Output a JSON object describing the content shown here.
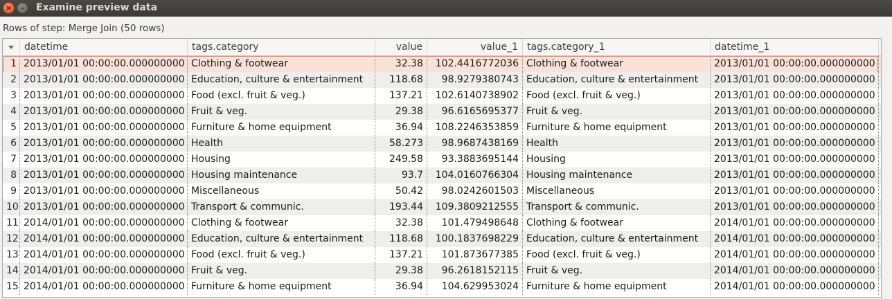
{
  "window": {
    "title": "Examine preview data"
  },
  "subtitle": "Rows of step: Merge Join (50 rows)",
  "columns": [
    "datetime",
    "tags.category",
    "value",
    "value_1",
    "tags.category_1",
    "datetime_1"
  ],
  "rows": [
    {
      "n": "1",
      "datetime": "2013/01/01 00:00:00.000000000",
      "category": "Clothing & footwear",
      "value": "32.38",
      "value_1": "102.4416772036",
      "category_1": "Clothing & footwear",
      "datetime_1": "2013/01/01 00:00:00.000000000"
    },
    {
      "n": "2",
      "datetime": "2013/01/01 00:00:00.000000000",
      "category": "Education, culture & entertainment",
      "value": "118.68",
      "value_1": "98.9279380743",
      "category_1": "Education, culture & entertainment",
      "datetime_1": "2013/01/01 00:00:00.000000000"
    },
    {
      "n": "3",
      "datetime": "2013/01/01 00:00:00.000000000",
      "category": "Food (excl. fruit & veg.)",
      "value": "137.21",
      "value_1": "102.6140738902",
      "category_1": "Food (excl. fruit & veg.)",
      "datetime_1": "2013/01/01 00:00:00.000000000"
    },
    {
      "n": "4",
      "datetime": "2013/01/01 00:00:00.000000000",
      "category": "Fruit & veg.",
      "value": "29.38",
      "value_1": "96.6165695377",
      "category_1": "Fruit & veg.",
      "datetime_1": "2013/01/01 00:00:00.000000000"
    },
    {
      "n": "5",
      "datetime": "2013/01/01 00:00:00.000000000",
      "category": "Furniture & home equipment",
      "value": "36.94",
      "value_1": "108.2246353859",
      "category_1": "Furniture & home equipment",
      "datetime_1": "2013/01/01 00:00:00.000000000"
    },
    {
      "n": "6",
      "datetime": "2013/01/01 00:00:00.000000000",
      "category": "Health",
      "value": "58.273",
      "value_1": "98.9687438169",
      "category_1": "Health",
      "datetime_1": "2013/01/01 00:00:00.000000000"
    },
    {
      "n": "7",
      "datetime": "2013/01/01 00:00:00.000000000",
      "category": "Housing",
      "value": "249.58",
      "value_1": "93.3883695144",
      "category_1": "Housing",
      "datetime_1": "2013/01/01 00:00:00.000000000"
    },
    {
      "n": "8",
      "datetime": "2013/01/01 00:00:00.000000000",
      "category": "Housing maintenance",
      "value": "93.7",
      "value_1": "104.0160766304",
      "category_1": "Housing maintenance",
      "datetime_1": "2013/01/01 00:00:00.000000000"
    },
    {
      "n": "9",
      "datetime": "2013/01/01 00:00:00.000000000",
      "category": "Miscellaneous",
      "value": "50.42",
      "value_1": "98.0242601503",
      "category_1": "Miscellaneous",
      "datetime_1": "2013/01/01 00:00:00.000000000"
    },
    {
      "n": "10",
      "datetime": "2013/01/01 00:00:00.000000000",
      "category": "Transport & communic.",
      "value": "193.44",
      "value_1": "109.3809212555",
      "category_1": "Transport & communic.",
      "datetime_1": "2013/01/01 00:00:00.000000000"
    },
    {
      "n": "11",
      "datetime": "2014/01/01 00:00:00.000000000",
      "category": "Clothing & footwear",
      "value": "32.38",
      "value_1": "101.479498648",
      "category_1": "Clothing & footwear",
      "datetime_1": "2014/01/01 00:00:00.000000000"
    },
    {
      "n": "12",
      "datetime": "2014/01/01 00:00:00.000000000",
      "category": "Education, culture & entertainment",
      "value": "118.68",
      "value_1": "100.1837698229",
      "category_1": "Education, culture & entertainment",
      "datetime_1": "2014/01/01 00:00:00.000000000"
    },
    {
      "n": "13",
      "datetime": "2014/01/01 00:00:00.000000000",
      "category": "Food (excl. fruit & veg.)",
      "value": "137.21",
      "value_1": "101.873677385",
      "category_1": "Food (excl. fruit & veg.)",
      "datetime_1": "2014/01/01 00:00:00.000000000"
    },
    {
      "n": "14",
      "datetime": "2014/01/01 00:00:00.000000000",
      "category": "Fruit & veg.",
      "value": "29.38",
      "value_1": "96.2618152115",
      "category_1": "Fruit & veg.",
      "datetime_1": "2014/01/01 00:00:00.000000000"
    },
    {
      "n": "15",
      "datetime": "2014/01/01 00:00:00.000000000",
      "category": "Furniture & home equipment",
      "value": "36.94",
      "value_1": "104.629953024",
      "category_1": "Furniture & home equipment",
      "datetime_1": "2014/01/01 00:00:00.000000000"
    }
  ]
}
